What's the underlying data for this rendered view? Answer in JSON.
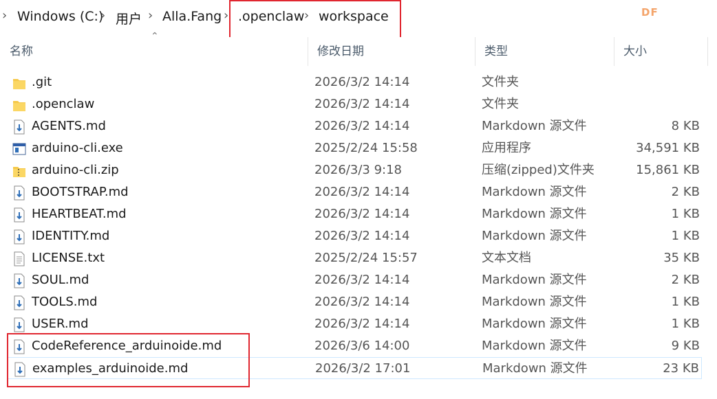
{
  "address": {
    "crumbs": [
      "Windows (C:)",
      "用户",
      "Alla.Fang",
      ".openclaw",
      "workspace"
    ]
  },
  "watermark": "DF",
  "columns": {
    "name": "名称",
    "date": "修改日期",
    "type": "类型",
    "size": "大小"
  },
  "files": [
    {
      "name": ".git",
      "date": "2026/3/2 14:14",
      "type": "文件夹",
      "size": "",
      "icon": "folder-icon"
    },
    {
      "name": ".openclaw",
      "date": "2026/3/2 14:14",
      "type": "文件夹",
      "size": "",
      "icon": "folder-icon"
    },
    {
      "name": "AGENTS.md",
      "date": "2026/3/2 14:14",
      "type": "Markdown 源文件",
      "size": "8 KB",
      "icon": "markdown-file-icon"
    },
    {
      "name": "arduino-cli.exe",
      "date": "2025/2/24 15:58",
      "type": "应用程序",
      "size": "34,591 KB",
      "icon": "exe-file-icon"
    },
    {
      "name": "arduino-cli.zip",
      "date": "2026/3/3 9:18",
      "type": "压缩(zipped)文件夹",
      "size": "15,861 KB",
      "icon": "zip-folder-icon"
    },
    {
      "name": "BOOTSTRAP.md",
      "date": "2026/3/2 14:14",
      "type": "Markdown 源文件",
      "size": "2 KB",
      "icon": "markdown-file-icon"
    },
    {
      "name": "HEARTBEAT.md",
      "date": "2026/3/2 14:14",
      "type": "Markdown 源文件",
      "size": "1 KB",
      "icon": "markdown-file-icon"
    },
    {
      "name": "IDENTITY.md",
      "date": "2026/3/2 14:14",
      "type": "Markdown 源文件",
      "size": "1 KB",
      "icon": "markdown-file-icon"
    },
    {
      "name": "LICENSE.txt",
      "date": "2025/2/24 15:57",
      "type": "文本文档",
      "size": "35 KB",
      "icon": "text-file-icon"
    },
    {
      "name": "SOUL.md",
      "date": "2026/3/2 14:14",
      "type": "Markdown 源文件",
      "size": "2 KB",
      "icon": "markdown-file-icon"
    },
    {
      "name": "TOOLS.md",
      "date": "2026/3/2 14:14",
      "type": "Markdown 源文件",
      "size": "1 KB",
      "icon": "markdown-file-icon"
    },
    {
      "name": "USER.md",
      "date": "2026/3/2 14:14",
      "type": "Markdown 源文件",
      "size": "1 KB",
      "icon": "markdown-file-icon"
    },
    {
      "name": "CodeReference_arduinoide.md",
      "date": "2026/3/6 14:00",
      "type": "Markdown 源文件",
      "size": "9 KB",
      "icon": "markdown-file-icon"
    },
    {
      "name": "examples_arduinoide.md",
      "date": "2026/3/2 17:01",
      "type": "Markdown 源文件",
      "size": "23 KB",
      "icon": "markdown-file-icon"
    }
  ],
  "colors": {
    "annotation": "#e0262f",
    "folder": "#f6c94a",
    "markdown_arrow": "#2f6fb8"
  }
}
